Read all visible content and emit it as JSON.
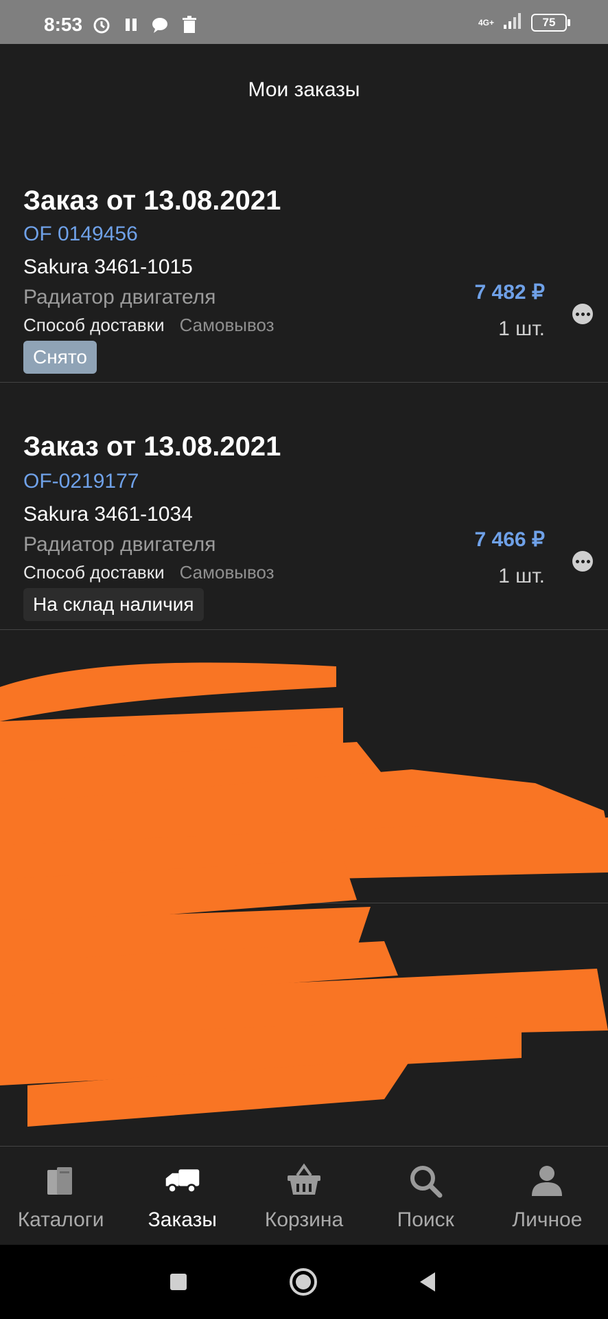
{
  "status_bar": {
    "time": "8:53",
    "network": "4G+",
    "battery": "75"
  },
  "header": {
    "title": "Мои заказы"
  },
  "orders": [
    {
      "date": "Заказ от 13.08.2021",
      "number": "OF 0149456",
      "sku": "Sakura 3461-1015",
      "name": "Радиатор двигателя",
      "delivery_label": "Способ доставки",
      "delivery_value": "Самовывоз",
      "price": "7 482 ₽",
      "qty": "1 шт.",
      "status": "Снято"
    },
    {
      "date": "Заказ от 13.08.2021",
      "number": "OF-0219177",
      "sku": "Sakura 3461-1034",
      "name": "Радиатор двигателя",
      "delivery_label": "Способ доставки",
      "delivery_value": "Самовывоз",
      "price": "7 466 ₽",
      "qty": "1 шт.",
      "status": "На склад наличия"
    }
  ],
  "nav": {
    "items": [
      {
        "label": "Каталоги",
        "icon": "book-icon"
      },
      {
        "label": "Заказы",
        "icon": "truck-icon"
      },
      {
        "label": "Корзина",
        "icon": "basket-icon"
      },
      {
        "label": "Поиск",
        "icon": "search-icon"
      },
      {
        "label": "Личное",
        "icon": "person-icon"
      }
    ],
    "active_index": 1
  },
  "colors": {
    "accent": "#6fa1e8",
    "background": "#1e1e1e",
    "redaction": "#f97524"
  }
}
